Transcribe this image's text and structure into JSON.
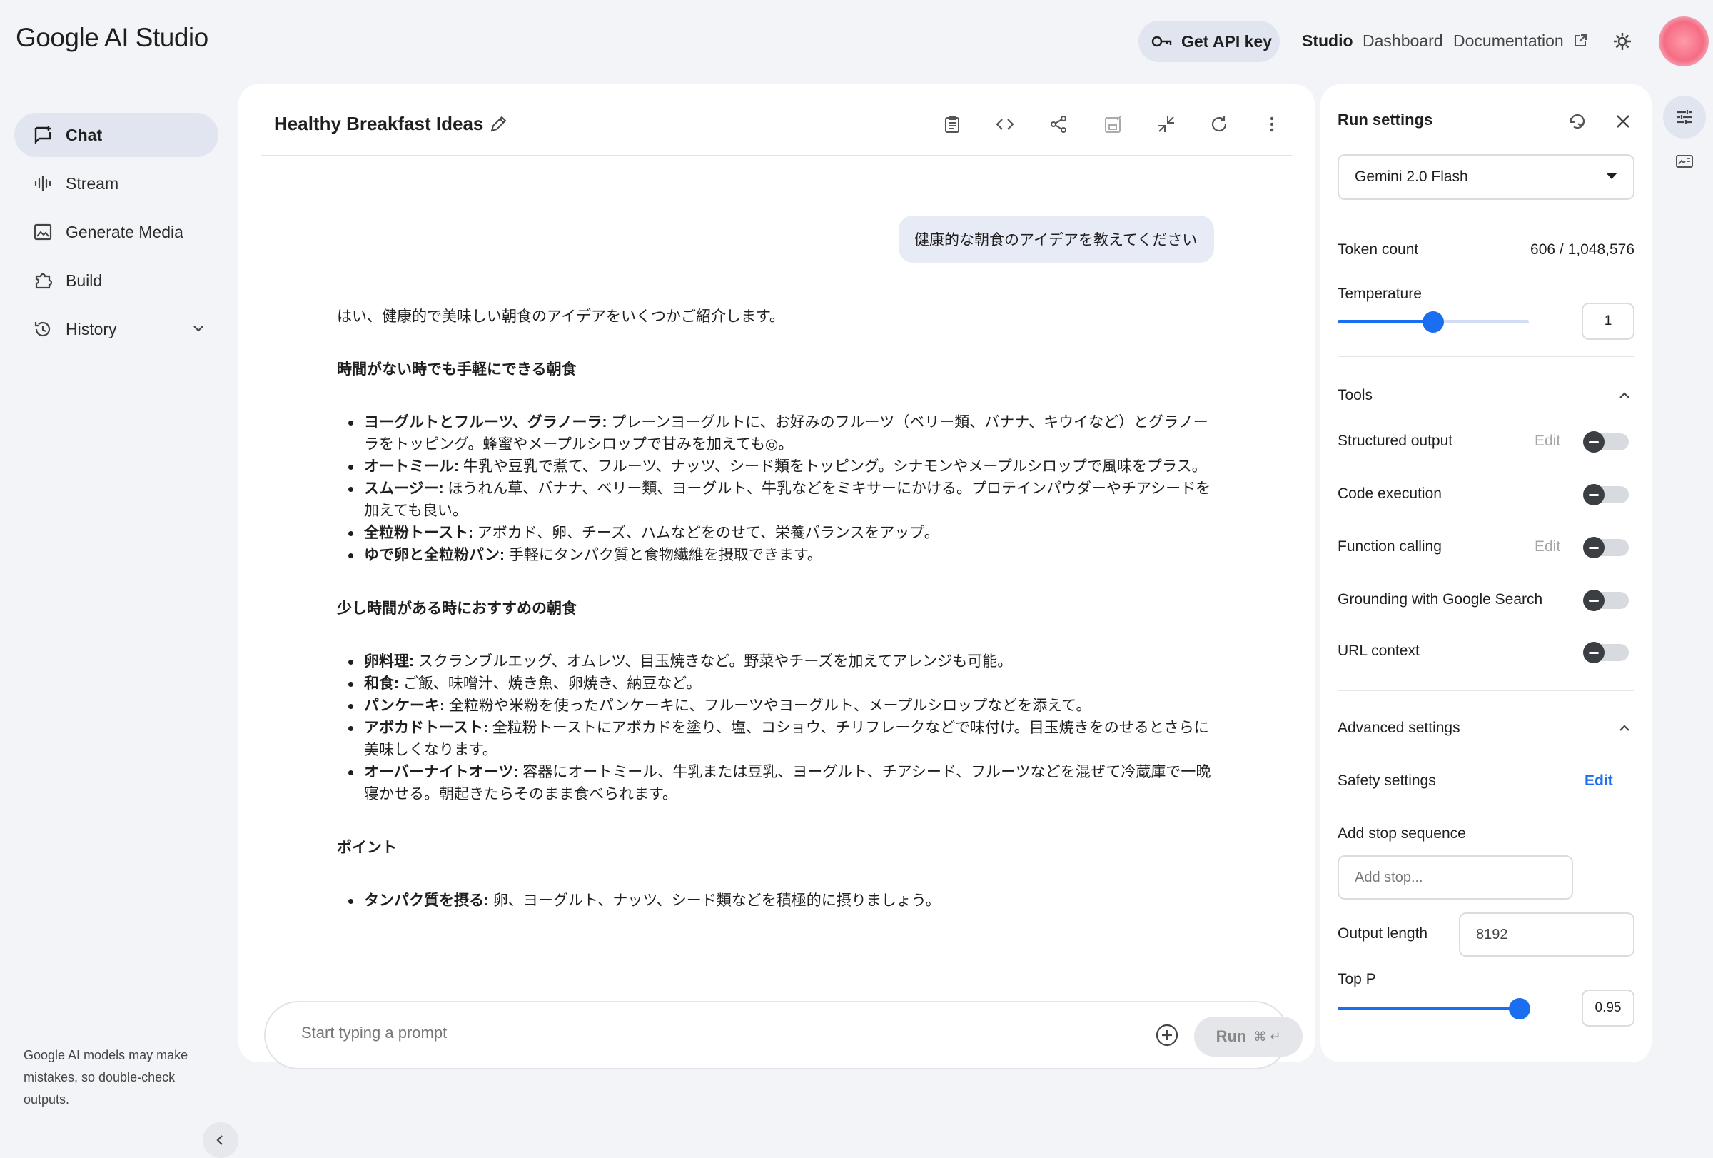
{
  "app": {
    "logo_text": "Google AI Studio",
    "api_key_label": "Get API key",
    "nav": [
      "Studio",
      "Dashboard",
      "Documentation"
    ]
  },
  "sidebar": {
    "items": [
      {
        "label": "Chat",
        "icon": "chat-icon"
      },
      {
        "label": "Stream",
        "icon": "stream-icon"
      },
      {
        "label": "Generate Media",
        "icon": "image-icon"
      },
      {
        "label": "Build",
        "icon": "build-icon"
      },
      {
        "label": "History",
        "icon": "history-icon"
      }
    ],
    "disclaimer": "Google AI models may make mistakes, so double-check outputs."
  },
  "chat": {
    "title": "Healthy Breakfast Ideas",
    "user_message": "健康的な朝食のアイデアを教えてください",
    "response": {
      "intro": "はい、健康的で美味しい朝食のアイデアをいくつかご紹介します。",
      "section1_title": "時間がない時でも手軽にできる朝食",
      "section1_items": [
        {
          "bold": "ヨーグルトとフルーツ、グラノーラ:",
          "text": " プレーンヨーグルトに、お好みのフルーツ（ベリー類、バナナ、キウイなど）とグラノーラをトッピング。蜂蜜やメープルシロップで甘みを加えても◎。"
        },
        {
          "bold": "オートミール:",
          "text": " 牛乳や豆乳で煮て、フルーツ、ナッツ、シード類をトッピング。シナモンやメープルシロップで風味をプラス。"
        },
        {
          "bold": "スムージー:",
          "text": " ほうれん草、バナナ、ベリー類、ヨーグルト、牛乳などをミキサーにかける。プロテインパウダーやチアシードを加えても良い。"
        },
        {
          "bold": "全粒粉トースト:",
          "text": " アボカド、卵、チーズ、ハムなどをのせて、栄養バランスをアップ。"
        },
        {
          "bold": "ゆで卵と全粒粉パン:",
          "text": " 手軽にタンパク質と食物繊維を摂取できます。"
        }
      ],
      "section2_title": "少し時間がある時におすすめの朝食",
      "section2_items": [
        {
          "bold": "卵料理:",
          "text": " スクランブルエッグ、オムレツ、目玉焼きなど。野菜やチーズを加えてアレンジも可能。"
        },
        {
          "bold": "和食:",
          "text": " ご飯、味噌汁、焼き魚、卵焼き、納豆など。"
        },
        {
          "bold": "パンケーキ:",
          "text": " 全粒粉や米粉を使ったパンケーキに、フルーツやヨーグルト、メープルシロップなどを添えて。"
        },
        {
          "bold": "アボカドトースト:",
          "text": " 全粒粉トーストにアボカドを塗り、塩、コショウ、チリフレークなどで味付け。目玉焼きをのせるとさらに美味しくなります。"
        },
        {
          "bold": "オーバーナイトオーツ:",
          "text": " 容器にオートミール、牛乳または豆乳、ヨーグルト、チアシード、フルーツなどを混ぜて冷蔵庫で一晩寝かせる。朝起きたらそのまま食べられます。"
        }
      ],
      "section3_title": "ポイント",
      "section3_items": [
        {
          "bold": "タンパク質を摂る:",
          "text": " 卵、ヨーグルト、ナッツ、シード類などを積極的に摂りましょう。"
        }
      ]
    },
    "prompt_placeholder": "Start typing a prompt",
    "run_label": "Run",
    "run_shortcut": "⌘ ↵"
  },
  "settings": {
    "title": "Run settings",
    "model": "Gemini 2.0 Flash",
    "token_count_label": "Token count",
    "token_count_value": "606 / 1,048,576",
    "temperature_label": "Temperature",
    "temperature_value": "1",
    "temperature_fraction": 0.5,
    "tools_label": "Tools",
    "tools": [
      {
        "label": "Structured output",
        "edit": "Edit"
      },
      {
        "label": "Code execution",
        "edit": ""
      },
      {
        "label": "Function calling",
        "edit": "Edit"
      },
      {
        "label": "Grounding with Google Search",
        "edit": ""
      },
      {
        "label": "URL context",
        "edit": ""
      }
    ],
    "advanced_label": "Advanced settings",
    "safety_label": "Safety settings",
    "safety_edit": "Edit",
    "stop_label": "Add stop sequence",
    "stop_placeholder": "Add stop...",
    "output_length_label": "Output length",
    "output_length_value": "8192",
    "top_p_label": "Top P",
    "top_p_value": "0.95",
    "top_p_fraction": 0.95
  },
  "colors": {
    "accent": "#1a6ef0",
    "background": "#f3f4f8",
    "active_pill": "#e1e5f0"
  }
}
